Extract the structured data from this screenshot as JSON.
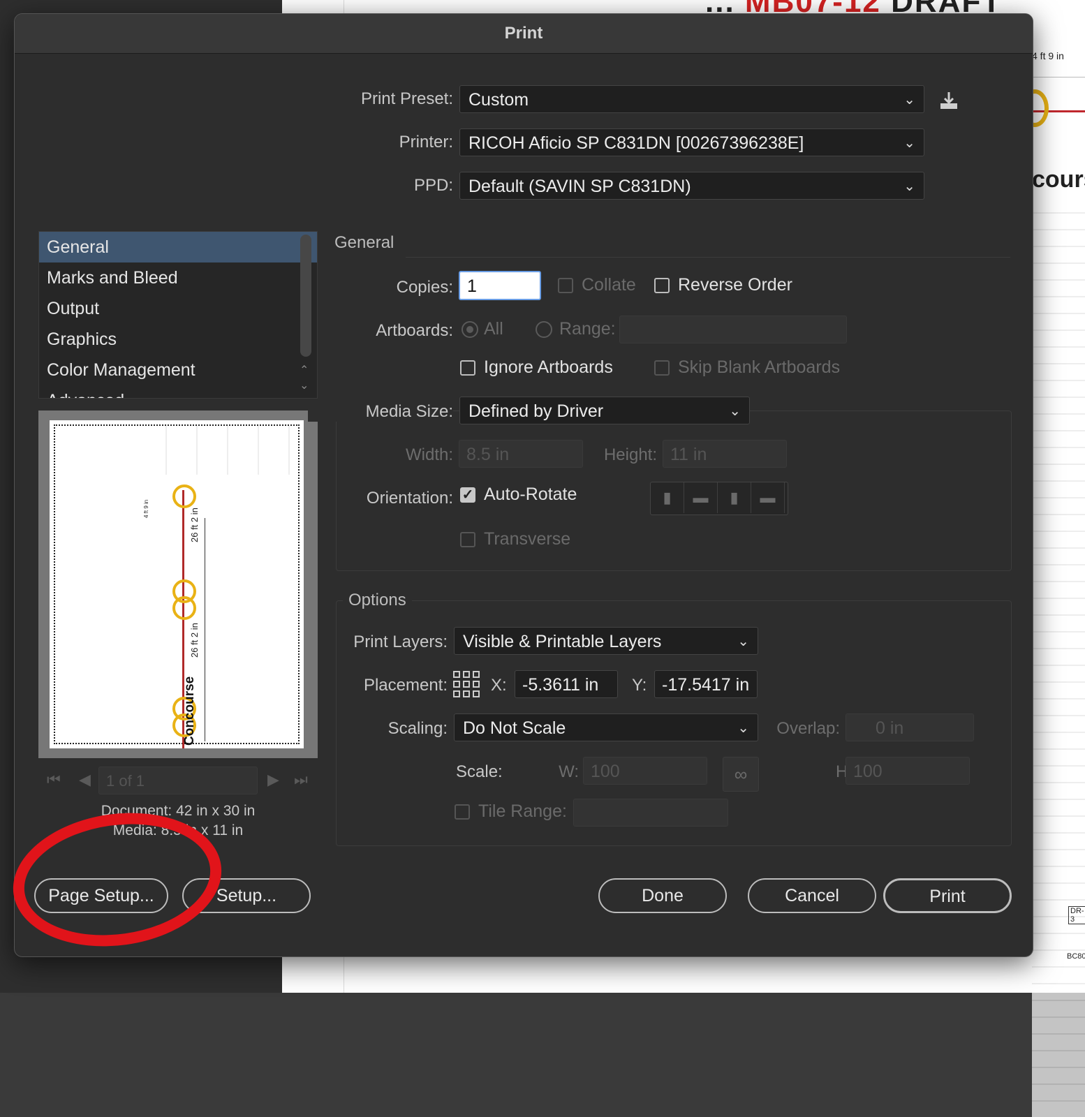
{
  "dialog": {
    "title": "Print"
  },
  "background": {
    "header_text_dark": "...",
    "header_text_red": "MB07-12",
    "header_text_dark2": "DRAFT",
    "dim_label": "4 ft 9 in",
    "concourse_partial": "cours",
    "tag1": "DR-3",
    "tag2": "BC80"
  },
  "top": {
    "preset_label": "Print Preset:",
    "preset_value": "Custom",
    "printer_label": "Printer:",
    "printer_value": "RICOH Aficio SP C831DN [00267396238E]",
    "ppd_label": "PPD:",
    "ppd_value": "Default (SAVIN SP C831DN)"
  },
  "categories": [
    "General",
    "Marks and Bleed",
    "Output",
    "Graphics",
    "Color Management",
    "Advanced"
  ],
  "preview": {
    "page_field": "1 of 1",
    "document_info": "Document: 42 in x 30 in",
    "media_info": "Media: 8.5 in x 11 in",
    "drawing_label_concourse": "Concourse",
    "drawing_label_dim1": "26 ft 2 in",
    "drawing_label_dim2": "26 ft 2 in",
    "drawing_label_small": "4 ft 9 in"
  },
  "general": {
    "section_title": "General",
    "copies_label": "Copies:",
    "copies_value": "1",
    "collate_label": "Collate",
    "reverse_label": "Reverse Order",
    "artboards_label": "Artboards:",
    "all_label": "All",
    "range_label": "Range:",
    "ignore_label": "Ignore Artboards",
    "skip_label": "Skip Blank Artboards",
    "media_label": "Media Size:",
    "media_value": "Defined by Driver",
    "width_label": "Width:",
    "width_value": "8.5 in",
    "height_label": "Height:",
    "height_value": "11 in",
    "orientation_label": "Orientation:",
    "autorotate_label": "Auto-Rotate",
    "transverse_label": "Transverse"
  },
  "options": {
    "section_title": "Options",
    "layers_label": "Print Layers:",
    "layers_value": "Visible & Printable Layers",
    "placement_label": "Placement:",
    "x_label": "X:",
    "x_value": "-5.3611 in",
    "y_label": "Y:",
    "y_value": "-17.5417 in",
    "scaling_label": "Scaling:",
    "scaling_value": "Do Not Scale",
    "overlap_label": "Overlap:",
    "overlap_value": "0 in",
    "scale_label": "Scale:",
    "w_label": "W:",
    "w_value": "100",
    "h_label": "H:",
    "h_value": "100",
    "tile_label": "Tile Range:"
  },
  "buttons": {
    "page_setup": "Page Setup...",
    "setup": "Setup...",
    "done": "Done",
    "cancel": "Cancel",
    "print": "Print"
  },
  "annotation": {
    "color": "#e1141a"
  }
}
